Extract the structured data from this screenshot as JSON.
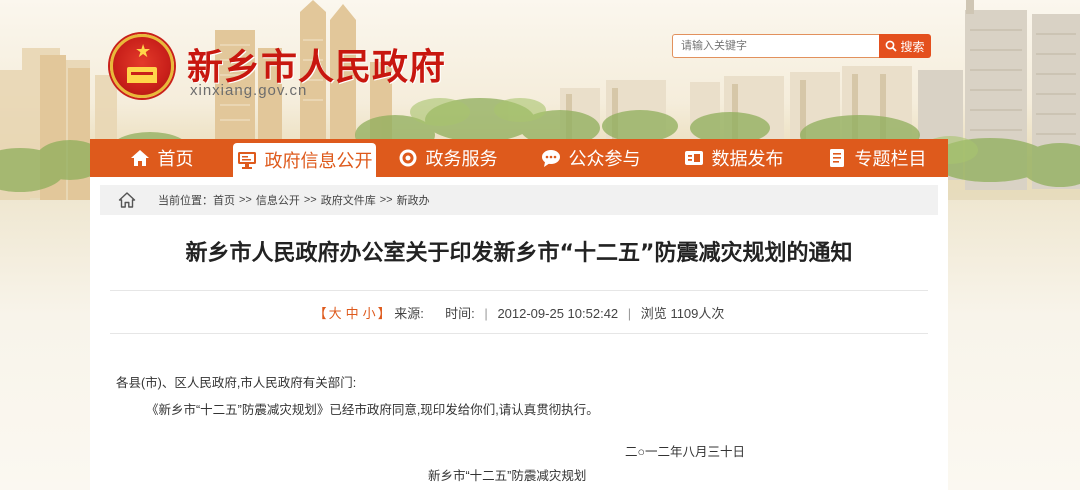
{
  "site": {
    "title": "新乡市人民政府",
    "domain": "xinxiang.gov.cn"
  },
  "search": {
    "placeholder": "请输入关键字",
    "button_label": "搜索"
  },
  "nav": {
    "items": [
      {
        "label": "首页",
        "icon": "home-icon"
      },
      {
        "label": "政府信息公开",
        "icon": "monitor-icon"
      },
      {
        "label": "政务服务",
        "icon": "service-icon"
      },
      {
        "label": "公众参与",
        "icon": "chat-icon"
      },
      {
        "label": "数据发布",
        "icon": "data-icon"
      },
      {
        "label": "专题栏目",
        "icon": "document-icon"
      }
    ],
    "active_index": 1
  },
  "breadcrumb": {
    "prefix": "当前位置：",
    "items": [
      "首页",
      "信息公开",
      "政府文件库",
      "新政办"
    ],
    "separator": ">>"
  },
  "article": {
    "title": "新乡市人民政府办公室关于印发新乡市“十二五”防震减灾规划的通知",
    "font_size_label_open": "【",
    "font_size_options": [
      "大",
      "中",
      "小"
    ],
    "font_size_label_close": "】",
    "source_label": "来源:",
    "time_label": "时间:",
    "time_value": "2012-09-25 10:52:42",
    "views_label": "浏览",
    "views_value": "1109人次",
    "salutation": "各县(市)、区人民政府,市人民政府有关部门:",
    "paragraph1": "《新乡市“十二五”防震减灾规划》已经市政府同意,现印发给你们,请认真贯彻执行。",
    "date": "二○一二年八月三十日",
    "attachment_title": "新乡市“十二五”防震减灾规划"
  },
  "colors": {
    "brand_red": "#c8170f",
    "nav_orange": "#de5a1c",
    "search_button": "#e4501e"
  }
}
